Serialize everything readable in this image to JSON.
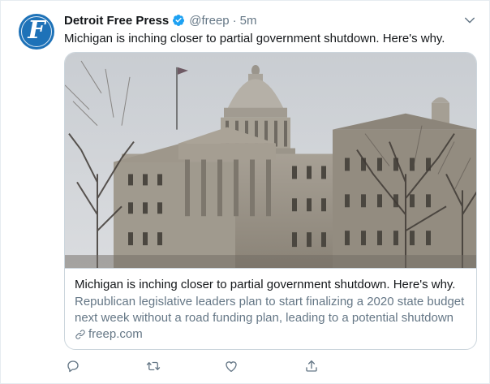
{
  "tweet": {
    "author_name": "Detroit Free Press",
    "handle": "@freep",
    "separator": "·",
    "timestamp": "5m",
    "avatar_letter": "F",
    "text": "Michigan is inching closer to partial government shutdown. Here's why."
  },
  "card": {
    "image_icon": "michigan-capitol-photo",
    "title": "Michigan is inching closer to partial government shutdown. Here's why.",
    "description": "Republican legislative leaders plan to start finalizing a 2020 state budget next week without a road funding plan, leading to a potential shutdown",
    "domain": "freep.com"
  },
  "icons": {
    "verified": "verified-badge-icon",
    "caret": "chevron-down-icon",
    "reply": "reply-icon",
    "retweet": "retweet-icon",
    "like": "heart-icon",
    "share": "share-icon",
    "link": "link-icon"
  },
  "colors": {
    "verified_blue": "#1da1f2",
    "text_primary": "#14171a",
    "text_secondary": "#657786",
    "border": "#ccd6dd",
    "avatar_bg": "#1e72b8"
  }
}
